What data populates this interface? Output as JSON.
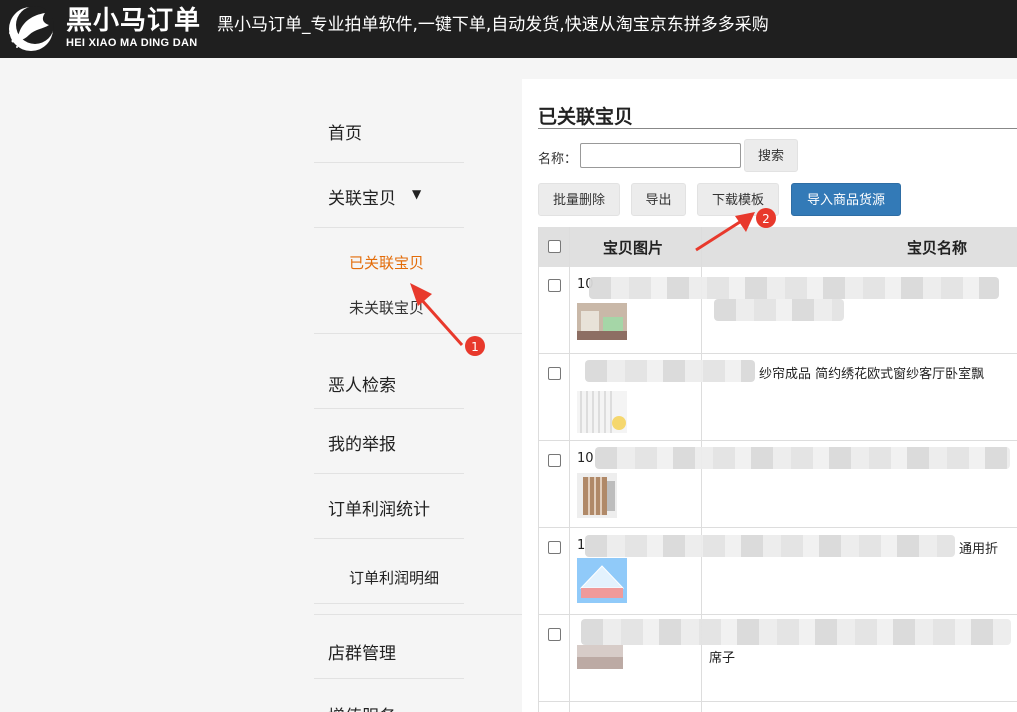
{
  "header": {
    "logo_cn": "黑小马订单",
    "logo_en": "HEI XIAO MA DING DAN",
    "site_title": "黑小马订单_专业拍单软件,一键下单,自动发货,快速从淘宝京东拼多多采购"
  },
  "sidebar": {
    "home": "首页",
    "linked_goods": "关联宝贝",
    "linked_goods_caret": "▼",
    "sub_linked": "已关联宝贝",
    "sub_unlinked": "未关联宝贝",
    "malicious_search": "恶人检索",
    "my_reports": "我的举报",
    "order_profit": "订单利润统计",
    "order_profit_detail": "订单利润明细",
    "shop_group": "店群管理",
    "more": "增值服务"
  },
  "main": {
    "title": "已关联宝贝",
    "search_label": "名称：",
    "search_value": "",
    "search_button": "搜索",
    "batch_delete": "批量删除",
    "export": "导出",
    "download_template": "下载模板",
    "import_source": "导入商品货源",
    "columns": [
      "宝贝图片",
      "宝贝名称"
    ],
    "rows": [
      {
        "id_prefix": "10",
        "name_fragment": "",
        "name_suffix": "",
        "line2": ""
      },
      {
        "id_prefix": "",
        "name_fragment": "纱帘成品 简约绣花欧式窗纱客厅卧室飘",
        "name_suffix": "",
        "line2": ""
      },
      {
        "id_prefix": "10",
        "name_fragment": "",
        "name_suffix": "",
        "line2": ""
      },
      {
        "id_prefix": "1",
        "name_fragment": "",
        "name_suffix": "通用折",
        "line2": ""
      },
      {
        "id_prefix": "",
        "name_fragment": "",
        "name_suffix": "",
        "line2": "席子"
      }
    ]
  },
  "annotations": {
    "marker_1": "1",
    "marker_2": "2"
  },
  "colors": {
    "header_bg": "#1f1f1f",
    "active_sub": "#e36c09",
    "primary_button": "#337ab7",
    "annotation_red": "#e8392c"
  }
}
